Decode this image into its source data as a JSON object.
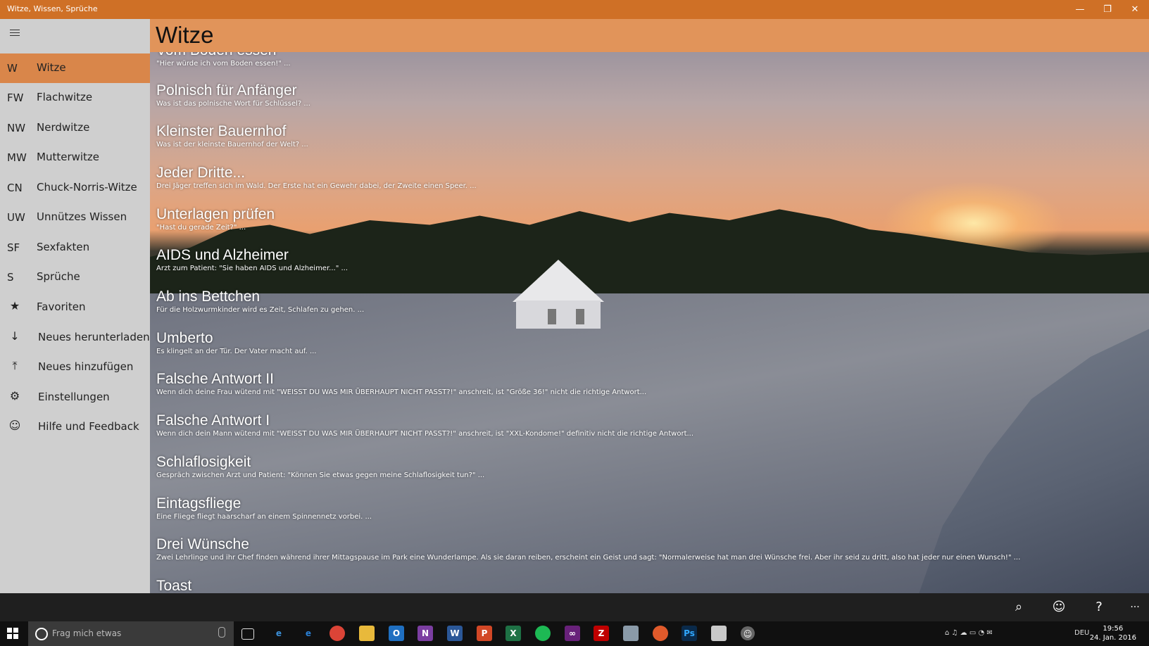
{
  "window": {
    "title": "Witze, Wissen, Sprüche"
  },
  "sidebar": {
    "items": [
      {
        "abbr": "W",
        "label": "Witze",
        "active": true
      },
      {
        "abbr": "FW",
        "label": "Flachwitze"
      },
      {
        "abbr": "NW",
        "label": "Nerdwitze"
      },
      {
        "abbr": "MW",
        "label": "Mutterwitze"
      },
      {
        "abbr": "CN",
        "label": "Chuck-Norris-Witze"
      },
      {
        "abbr": "UW",
        "label": "Unnützes Wissen"
      },
      {
        "abbr": "SF",
        "label": "Sexfakten"
      },
      {
        "abbr": "S",
        "label": "Sprüche"
      }
    ],
    "actions": [
      {
        "icon": "star-icon",
        "label": "Favoriten"
      },
      {
        "icon": "download-icon",
        "label": "Neues herunterladen"
      },
      {
        "icon": "upload-icon",
        "label": "Neues hinzufügen"
      },
      {
        "icon": "gear-icon",
        "label": "Einstellungen"
      },
      {
        "icon": "smiley-icon",
        "label": "Hilfe und Feedback"
      }
    ]
  },
  "header": {
    "title": "Witze"
  },
  "jokes": [
    {
      "title": "Vom Boden essen",
      "snippet": "\"Hier würde ich vom Boden essen!\" ..."
    },
    {
      "title": "Polnisch für Anfänger",
      "snippet": "Was ist das polnische Wort für Schlüssel? ..."
    },
    {
      "title": "Kleinster Bauernhof",
      "snippet": "Was ist der kleinste Bauernhof der Welt? ..."
    },
    {
      "title": "Jeder Dritte...",
      "snippet": "Drei Jäger treffen sich im Wald. Der Erste hat ein Gewehr dabei, der Zweite einen Speer. ..."
    },
    {
      "title": "Unterlagen prüfen",
      "snippet": "\"Hast du gerade Zeit?\" ..."
    },
    {
      "title": "AIDS und Alzheimer",
      "snippet": "Arzt zum Patient: \"Sie haben AIDS und Alzheimer...\" ..."
    },
    {
      "title": "Ab ins Bettchen",
      "snippet": "Für die Holzwurmkinder wird es Zeit, Schlafen zu gehen. ..."
    },
    {
      "title": "Umberto",
      "snippet": "Es klingelt an der Tür. Der Vater macht auf. ..."
    },
    {
      "title": "Falsche Antwort II",
      "snippet": "Wenn dich deine Frau wütend mit \"WEISST DU WAS MIR ÜBERHAUPT NICHT PASST?!\" anschreit, ist \"Größe 36!\" nicht die richtige Antwort..."
    },
    {
      "title": "Falsche Antwort I",
      "snippet": "Wenn dich dein Mann wütend mit \"WEISST DU WAS MIR ÜBERHAUPT NICHT PASST?!\" anschreit, ist \"XXL-Kondome!\" definitiv nicht die richtige Antwort..."
    },
    {
      "title": "Schlaflosigkeit",
      "snippet": "Gespräch zwischen Arzt und Patient: \"Können Sie etwas gegen meine Schlaflosigkeit tun?\" ..."
    },
    {
      "title": "Eintagsfliege",
      "snippet": "Eine Fliege fliegt haarscharf an einem Spinnennetz vorbei. ..."
    },
    {
      "title": "Drei Wünsche",
      "snippet": "Zwei Lehrlinge und ihr Chef finden während ihrer Mittagspause im Park eine Wunderlampe. Als sie daran reiben, erscheint ein Geist und sagt: \"Normalerweise hat man drei Wünsche frei. Aber ihr seid zu dritt, also hat jeder nur einen Wunsch!\" ..."
    },
    {
      "title": "Toast",
      "snippet": ""
    }
  ],
  "appbar": {
    "more_label": "···"
  },
  "taskbar": {
    "search_placeholder": "Frag mich etwas",
    "language": "DEU",
    "time": "19:56",
    "date": "24. Jan. 2016"
  },
  "colors": {
    "titlebar": "#cf7026",
    "header": "#e1945a",
    "active_item": "#d9864a",
    "sidebar": "#cfcfcf"
  }
}
